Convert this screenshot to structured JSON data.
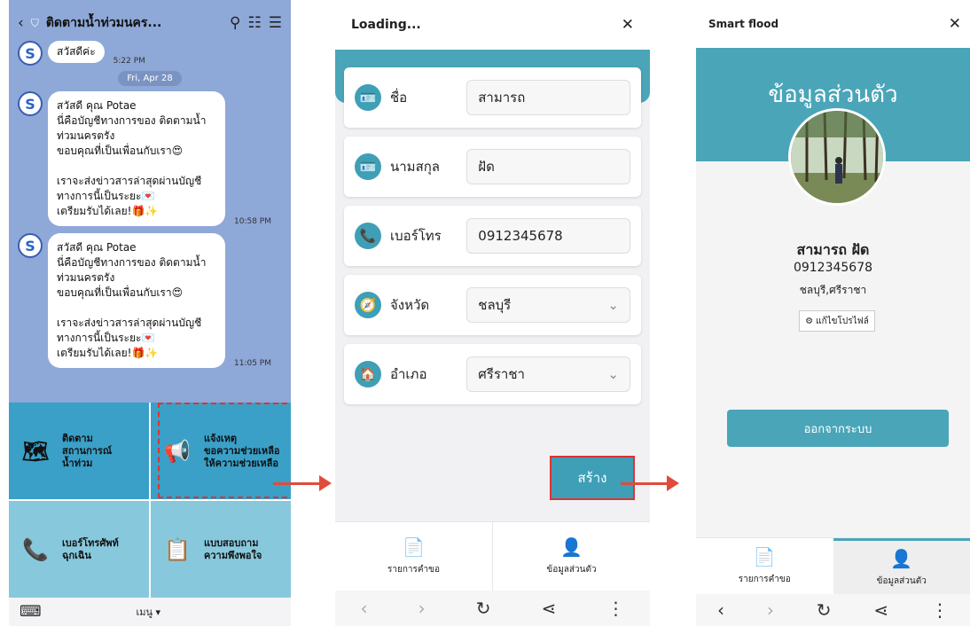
{
  "chat": {
    "title": "ติดตามน้ำท่วมนคร...",
    "greeting": "สวัสดีค่ะ",
    "greeting_time": "5:22 PM",
    "date_chip": "Fri, Apr 28",
    "messages": [
      {
        "text": "สวัสดี คุณ Potae\nนี่คือบัญชีทางการของ ติดตามน้ำ\nท่วมนครตรัง\nขอบคุณที่เป็นเพื่อนกับเรา😍\n\nเราจะส่งข่าวสารล่าสุดผ่านบัญชี\nทางการนี้เป็นระยะ💌\nเตรียมรับได้เลย!🎁✨",
        "time": "10:58 PM"
      },
      {
        "text": "สวัสดี คุณ Potae\nนี่คือบัญชีทางการของ ติดตามน้ำ\nท่วมนครตรัง\nขอบคุณที่เป็นเพื่อนกับเรา😍\n\nเราจะส่งข่าวสารล่าสุดผ่านบัญชี\nทางการนี้เป็นระยะ💌\nเตรียมรับได้เลย!🎁✨",
        "time": "11:05 PM"
      }
    ],
    "menu": [
      {
        "label": "ติดตาม\nสถานการณ์\nน้ำท่วม",
        "icon": "🗺"
      },
      {
        "label": "แจ้งเหตุ\nขอความช่วยเหลือ\nให้ความช่วยเหลือ",
        "icon": "📢"
      },
      {
        "label": "เบอร์โทรศัพท์\nฉุกเฉิน",
        "icon": "📞"
      },
      {
        "label": "แบบสอบถาม\nความพึงพอใจ",
        "icon": "📋"
      }
    ],
    "bottom_menu": "เมนู ▾"
  },
  "form": {
    "title": "Loading...",
    "fields": [
      {
        "label": "ชื่อ",
        "value": "สามารถ",
        "icon": "🪪"
      },
      {
        "label": "นามสกุล",
        "value": "ฝัด",
        "icon": "🪪"
      },
      {
        "label": "เบอร์โทร",
        "value": "0912345678",
        "icon": "📞"
      },
      {
        "label": "จังหวัด",
        "value": "ชลบุรี",
        "icon": "🧭",
        "select": true
      },
      {
        "label": "อำเภอ",
        "value": "ศรีราชา",
        "icon": "🏠",
        "select": true
      }
    ],
    "create_button": "สร้าง",
    "tabs": [
      {
        "label": "รายการคำขอ",
        "icon": "📄"
      },
      {
        "label": "ข้อมูลส่วนตัว",
        "icon": "👤"
      }
    ]
  },
  "profile": {
    "title": "Smart flood",
    "heading": "ข้อมูลส่วนตัว",
    "name": "สามารถ ฝัด",
    "phone": "0912345678",
    "location": "ชลบุรี,ศรีราชา",
    "edit_button": "แก้ไขโปรไฟล์",
    "logout_button": "ออกจากระบบ",
    "tabs": [
      {
        "label": "รายการคำขอ",
        "icon": "📄"
      },
      {
        "label": "ข้อมูลส่วนตัว",
        "icon": "👤"
      }
    ]
  },
  "icons": {
    "back": "‹",
    "forward": "›",
    "reload": "↻",
    "share": "⋖",
    "more": "⋮",
    "close": "✕",
    "search": "⚲",
    "list": "☷",
    "hamburger": "☰",
    "keyboard": "⌨",
    "chevron": "⌄",
    "gear": "⚙"
  }
}
